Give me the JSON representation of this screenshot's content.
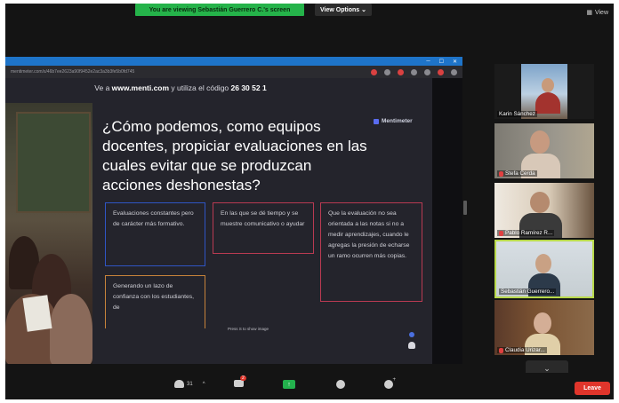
{
  "banner": {
    "viewing": "You are viewing Sebastián Guerrero C.'s screen",
    "view_options": "View Options ⌄",
    "view": "View"
  },
  "browser": {
    "url": "mentimeter.com/s/46b7ee2623a90f9452e2ac3a3b3fe5b0fd745",
    "prompt_text": "Ve a ",
    "prompt_site": "www.menti.com",
    "prompt_middle": " y utiliza el código ",
    "prompt_code": "26 30 52 1"
  },
  "slide": {
    "question": "¿Cómo podemos, como equipos docentes, propiciar evaluaciones en las cuales evitar que se produzcan acciones deshonestas?",
    "logo": "Mentimeter",
    "responses": [
      "Evaluaciones constantes pero de carácter más formativo.",
      "En las que se dé tiempo y se muestre comunicativo o ayudar",
      "Que la evaluación no sea orientada a las notas si no a medir aprendizajes, cuando le agregas la presión de echarse un ramo ocurren más copias.",
      "Generando un lazo de confianza con los estudiantes, de"
    ],
    "press_hint": "Press S to show image"
  },
  "participants": [
    {
      "name": "Karin Sánchez",
      "muted": false,
      "active": false
    },
    {
      "name": "Stefa Cerda",
      "muted": true,
      "active": false
    },
    {
      "name": "Pablo Ramírez R...",
      "muted": true,
      "active": false
    },
    {
      "name": "Sebastián Guerrero...",
      "muted": false,
      "active": true
    },
    {
      "name": "Claudia Urizar...",
      "muted": true,
      "active": false
    }
  ],
  "controls": {
    "participants_count": "31",
    "chat_badge": "2",
    "share_glyph": "↑",
    "leave": "Leave",
    "collapse_glyph": "⌄"
  },
  "colors": {
    "banner_green": "#25b34a",
    "leave_red": "#e0352b",
    "active_speaker": "#b8d94a",
    "card_blue": "#2f55c4",
    "card_red": "#b93a52",
    "card_orange": "#c7833a"
  }
}
